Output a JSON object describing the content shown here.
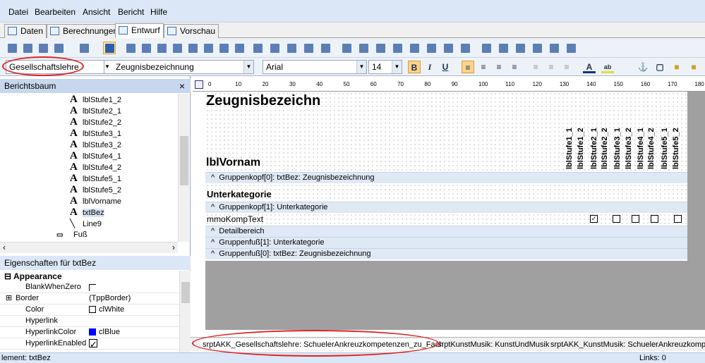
{
  "menu": [
    "Datei",
    "Bearbeiten",
    "Ansicht",
    "Bericht",
    "Hilfe"
  ],
  "view_tabs": [
    "Daten",
    "Berechnungen",
    "Entwurf",
    "Vorschau"
  ],
  "format_bar": {
    "section": "Gesellschaftslehre",
    "field": "Zeugnisbezeichnung",
    "font": "Arial",
    "size": "14",
    "bold": "B",
    "italic": "I",
    "underline": "U"
  },
  "tree": {
    "title": "Berichtsbaum",
    "close": "×",
    "items": [
      "lblStufe1_2",
      "lblStufe2_1",
      "lblStufe2_2",
      "lblStufe3_1",
      "lblStufe3_2",
      "lblStufe4_1",
      "lblStufe4_2",
      "lblStufe5_1",
      "lblStufe5_2",
      "lblVorname",
      "txtBez",
      "Line9",
      "Fuß"
    ],
    "selected": "txtBez"
  },
  "props": {
    "title": "Eigenschaften für txtBez",
    "group": "Appearance",
    "rows": [
      {
        "name": "BlankWhenZero",
        "value": ""
      },
      {
        "name": "Border",
        "value": "(TppBorder)"
      },
      {
        "name": "Color",
        "value": "clWhite"
      },
      {
        "name": "Hyperlink",
        "value": ""
      },
      {
        "name": "HyperlinkColor",
        "value": "clBlue"
      },
      {
        "name": "HyperlinkEnabled",
        "value": ""
      }
    ]
  },
  "ruler_ticks": [
    "0",
    "10",
    "20",
    "30",
    "40",
    "50",
    "60",
    "70",
    "80",
    "90",
    "100",
    "110",
    "120",
    "130",
    "140",
    "150",
    "160",
    "170",
    "180"
  ],
  "design": {
    "title_field": "Zeugnisbezeichn",
    "vorname": "lblVornam",
    "stufen": [
      "lblStufe1_1",
      "lblStufe1_2",
      "lblStufe2_1",
      "lblStufe2_2",
      "lblStufe3_1",
      "lblStufe3_2",
      "lblStufe4_1",
      "lblStufe4_2",
      "lblStufe5_1",
      "lblStufe5_2"
    ],
    "unterkategorie": "Unterkategorie",
    "mmo": "mmoKompText",
    "bands": [
      "Gruppenkopf[0]: txtBez: Zeugnisbezeichnung",
      "Gruppenkopf[1]: Unterkategorie",
      "Detailbereich",
      "Gruppenfuß[1]: Unterkategorie",
      "Gruppenfuß[0]: txtBez: Zeugnisbezeichnung"
    ],
    "band_caret": "^"
  },
  "report_tabs": [
    "srptAKK_Gesellschaftslehre: SchuelerAnkreuzkompetenzen_zu_Fach",
    "srptKunstMusik: KunstUndMusik",
    "srptAKK_KunstMusik: SchuelerAnkreuzkompe"
  ],
  "status": {
    "left": "lement: txtBez",
    "right": "Links: 0"
  },
  "colors": {
    "accent": "#d22222",
    "panel_title": "#c7d7ee",
    "menubar": "#dbe7f6"
  }
}
